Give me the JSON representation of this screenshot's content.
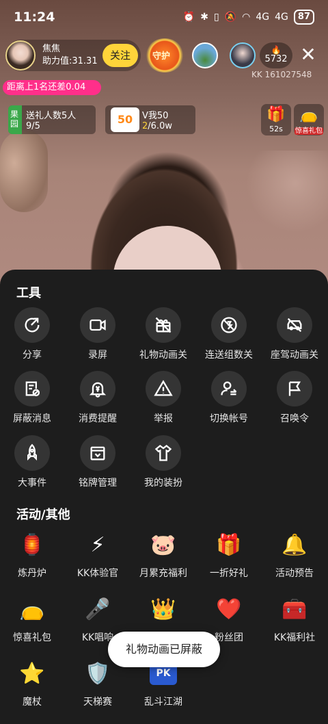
{
  "status": {
    "time": "11:24",
    "signal_1": "4G",
    "signal_2": "4G",
    "battery": "87"
  },
  "host": {
    "name": "焦焦",
    "score": "助力值:31.31",
    "follow_label": "关注"
  },
  "guard_label": "守护",
  "heat": {
    "value": "5732"
  },
  "kk_id": "KK 161027548",
  "rank_text": "距离上1名还差0.04",
  "task": {
    "tag": "果园",
    "title": "送礼人数5人",
    "progress": "9/5"
  },
  "vip": {
    "badge": "50",
    "title": "V我50",
    "progress_current": "2",
    "progress_total": "/6.0w"
  },
  "chest": {
    "timer": "52s",
    "gift_label": "惊喜礼包"
  },
  "tools": {
    "title": "工具",
    "items": [
      {
        "label": "分享",
        "icon": "share-icon"
      },
      {
        "label": "录屏",
        "icon": "video-icon"
      },
      {
        "label": "礼物动画关",
        "icon": "gift-off-icon"
      },
      {
        "label": "连送组数关",
        "icon": "combo-off-icon"
      },
      {
        "label": "座驾动画关",
        "icon": "car-off-icon"
      },
      {
        "label": "屏蔽消息",
        "icon": "block-message-icon"
      },
      {
        "label": "消费提醒",
        "icon": "bell-yen-icon"
      },
      {
        "label": "举报",
        "icon": "warning-icon"
      },
      {
        "label": "切换帐号",
        "icon": "switch-account-icon"
      },
      {
        "label": "召唤令",
        "icon": "flag-icon"
      },
      {
        "label": "大事件",
        "icon": "rocket-icon"
      },
      {
        "label": "铭牌管理",
        "icon": "nameplate-icon"
      },
      {
        "label": "我的装扮",
        "icon": "shirt-icon"
      }
    ]
  },
  "activities": {
    "title": "活动/其他",
    "items": [
      {
        "label": "炼丹炉",
        "icon": "furnace-icon",
        "color": "#8a4ad8"
      },
      {
        "label": "KK体验官",
        "icon": "lightning-badge-icon",
        "color": "#3ab0c8"
      },
      {
        "label": "月累充福利",
        "icon": "pink-pet-icon",
        "color": "#ff7ab0"
      },
      {
        "label": "一折好礼",
        "icon": "gift-box-icon",
        "color": "#a84af0"
      },
      {
        "label": "活动预告",
        "icon": "calendar-bell-icon",
        "color": "#ff8a3a"
      },
      {
        "label": "惊喜礼包",
        "icon": "red-bag-icon",
        "color": "#ff3a4a"
      },
      {
        "label": "KK唱响",
        "icon": "microphone-icon",
        "color": "#ff4a6a"
      },
      {
        "label": "",
        "icon": "crown-icon",
        "color": "#ffb02a"
      },
      {
        "label": "粉丝团",
        "icon": "heart-icon",
        "color": "#ff3a5a"
      },
      {
        "label": "KK福利社",
        "icon": "treasure-chest-icon",
        "color": "#ff6a2a"
      },
      {
        "label": "魔杖",
        "icon": "star-wand-icon",
        "color": "#ff9a3a"
      },
      {
        "label": "天梯赛",
        "icon": "sword-shield-icon",
        "color": "#ffc02a"
      },
      {
        "label": "乱斗江湖",
        "icon": "pk-shield-icon",
        "color": "#3a6ad8"
      }
    ]
  },
  "toast": "礼物动画已屏蔽"
}
